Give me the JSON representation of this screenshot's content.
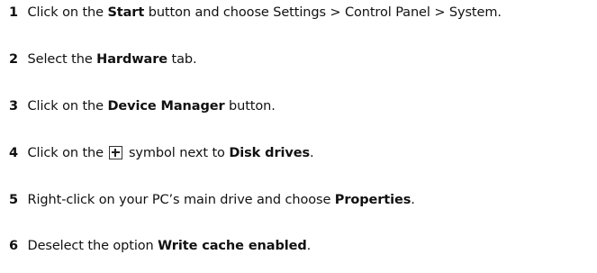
{
  "steps": [
    {
      "number": "1",
      "pre": "Click on the ",
      "bold": "Start",
      "post": " button and choose Settings > Control Panel > System."
    },
    {
      "number": "2",
      "pre": "Select the ",
      "bold": "Hardware",
      "post": " tab."
    },
    {
      "number": "3",
      "pre": "Click on the ",
      "bold": "Device Manager",
      "post": " button."
    },
    {
      "number": "4",
      "pre": "Click on the ",
      "mid": " symbol next to ",
      "bold": "Disk drives",
      "post": ".",
      "icon": "plus-box-icon"
    },
    {
      "number": "5",
      "pre": "Right-click on your PC’s main drive and choose ",
      "bold": "Properties",
      "post": "."
    },
    {
      "number": "6",
      "pre": "Deselect the option ",
      "bold": "Write cache enabled",
      "post": "."
    }
  ]
}
